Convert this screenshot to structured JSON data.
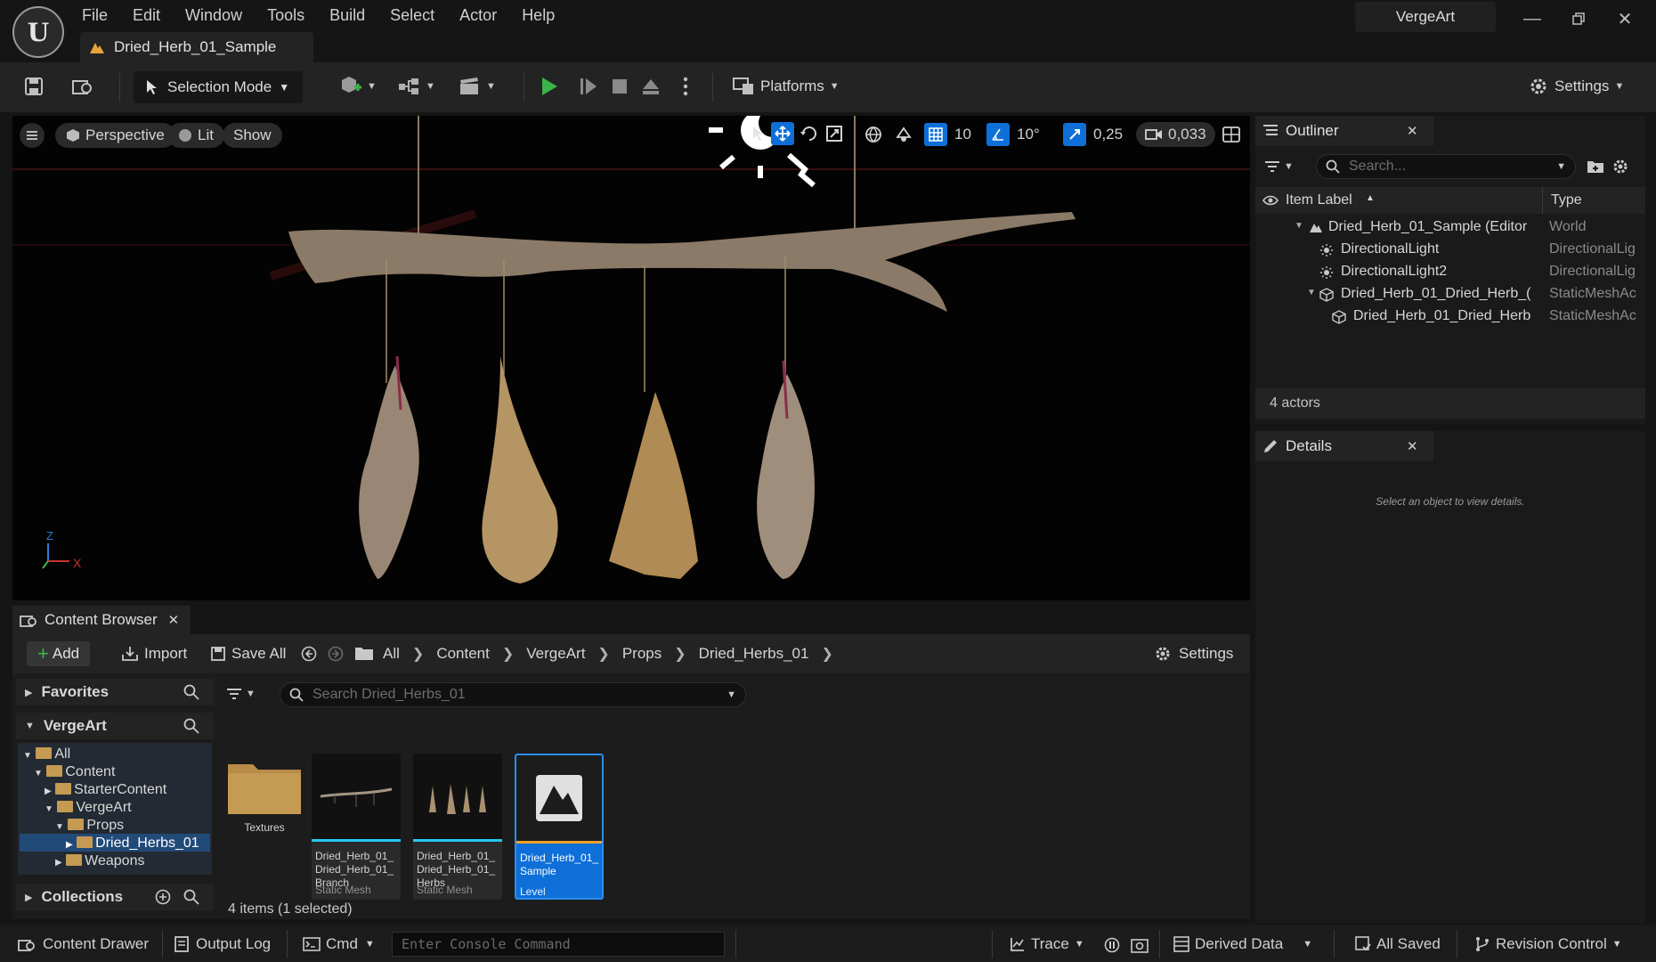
{
  "menu": [
    "File",
    "Edit",
    "Window",
    "Tools",
    "Build",
    "Select",
    "Actor",
    "Help"
  ],
  "document_tab": "Dried_Herb_01_Sample",
  "project_name": "VergeArt",
  "toolbar": {
    "selection_mode": "Selection Mode",
    "platforms": "Platforms",
    "settings": "Settings"
  },
  "viewport": {
    "perspective": "Perspective",
    "lit": "Lit",
    "show": "Show",
    "grid_snap": "10",
    "rotation_snap": "10°",
    "scale_snap": "0,25",
    "camera_speed": "0,033",
    "axis_x": "X",
    "axis_z": "Z"
  },
  "outliner": {
    "title": "Outliner",
    "search_placeholder": "Search...",
    "col_label": "Item Label",
    "col_type": "Type",
    "rows": [
      {
        "label": "Dried_Herb_01_Sample (Editor",
        "type": "World"
      },
      {
        "label": "DirectionalLight",
        "type": "DirectionalLig"
      },
      {
        "label": "DirectionalLight2",
        "type": "DirectionalLig"
      },
      {
        "label": "Dried_Herb_01_Dried_Herb_(",
        "type": "StaticMeshAc"
      },
      {
        "label": "Dried_Herb_01_Dried_Herb",
        "type": "StaticMeshAc"
      }
    ],
    "count": "4 actors"
  },
  "details": {
    "title": "Details",
    "empty_text": "Select an object to view details."
  },
  "content_browser": {
    "title": "Content Browser",
    "add": "Add",
    "import": "Import",
    "save_all": "Save All",
    "breadcrumb": [
      "All",
      "Content",
      "VergeArt",
      "Props",
      "Dried_Herbs_01"
    ],
    "settings": "Settings",
    "search_placeholder": "Search Dried_Herbs_01",
    "favorites": "Favorites",
    "root": "VergeArt",
    "collections": "Collections",
    "tree": [
      "All",
      "Content",
      "StarterContent",
      "VergeArt",
      "Props",
      "Dried_Herbs_01",
      "Weapons"
    ],
    "assets": [
      {
        "name": "Textures",
        "kind": ""
      },
      {
        "name": "Dried_Herb_01_ Dried_Herb_01_ Branch",
        "kind": "Static Mesh"
      },
      {
        "name": "Dried_Herb_01_ Dried_Herb_01_ Herbs",
        "kind": "Static Mesh"
      },
      {
        "name": "Dried_Herb_01_ Sample",
        "kind": "Level"
      }
    ],
    "items_count": "4 items (1 selected)"
  },
  "statusbar": {
    "content_drawer": "Content Drawer",
    "output_log": "Output Log",
    "cmd": "Cmd",
    "console_placeholder": "Enter Console Command",
    "trace": "Trace",
    "derived_data": "Derived Data",
    "all_saved": "All Saved",
    "revision_control": "Revision Control"
  },
  "colors": {
    "accent_blue": "#0e6fd8",
    "play_green": "#3cb44b",
    "folder": "#c59a53"
  }
}
